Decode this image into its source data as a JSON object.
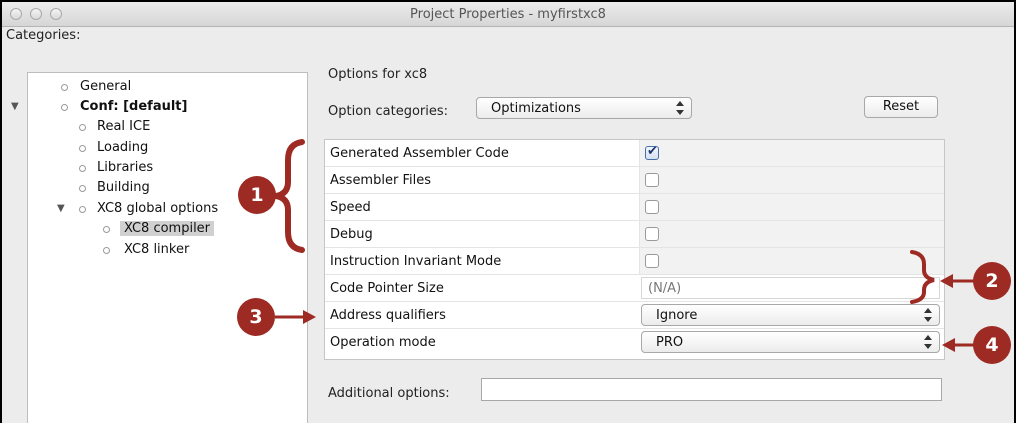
{
  "window": {
    "title": "Project Properties - myfirstxc8"
  },
  "categories": {
    "label": "Categories:",
    "nodes": [
      {
        "label": "General"
      },
      {
        "label": "Conf: [default]"
      },
      {
        "label": "Real ICE"
      },
      {
        "label": "Loading"
      },
      {
        "label": "Libraries"
      },
      {
        "label": "Building"
      },
      {
        "label": "XC8 global options"
      },
      {
        "label": "XC8 compiler"
      },
      {
        "label": "XC8 linker"
      }
    ],
    "selected": "XC8 compiler"
  },
  "options": {
    "title": "Options for xc8",
    "categories_label": "Option categories:",
    "category_value": "Optimizations",
    "reset_label": "Reset",
    "rows": [
      {
        "name": "Generated Assembler Code",
        "checked": true
      },
      {
        "name": "Assembler Files",
        "checked": false
      },
      {
        "name": "Speed",
        "checked": false
      },
      {
        "name": "Debug",
        "checked": false
      },
      {
        "name": "Instruction Invariant Mode",
        "checked": false
      },
      {
        "name": "Code Pointer Size",
        "value": "(N/A)"
      },
      {
        "name": "Address qualifiers",
        "value": "Ignore"
      },
      {
        "name": "Operation mode",
        "value": "PRO"
      }
    ],
    "additional_label": "Additional options:",
    "additional_value": ""
  },
  "callouts": [
    "1",
    "2",
    "3",
    "4"
  ],
  "colors": {
    "callout": "#9e2a24"
  }
}
